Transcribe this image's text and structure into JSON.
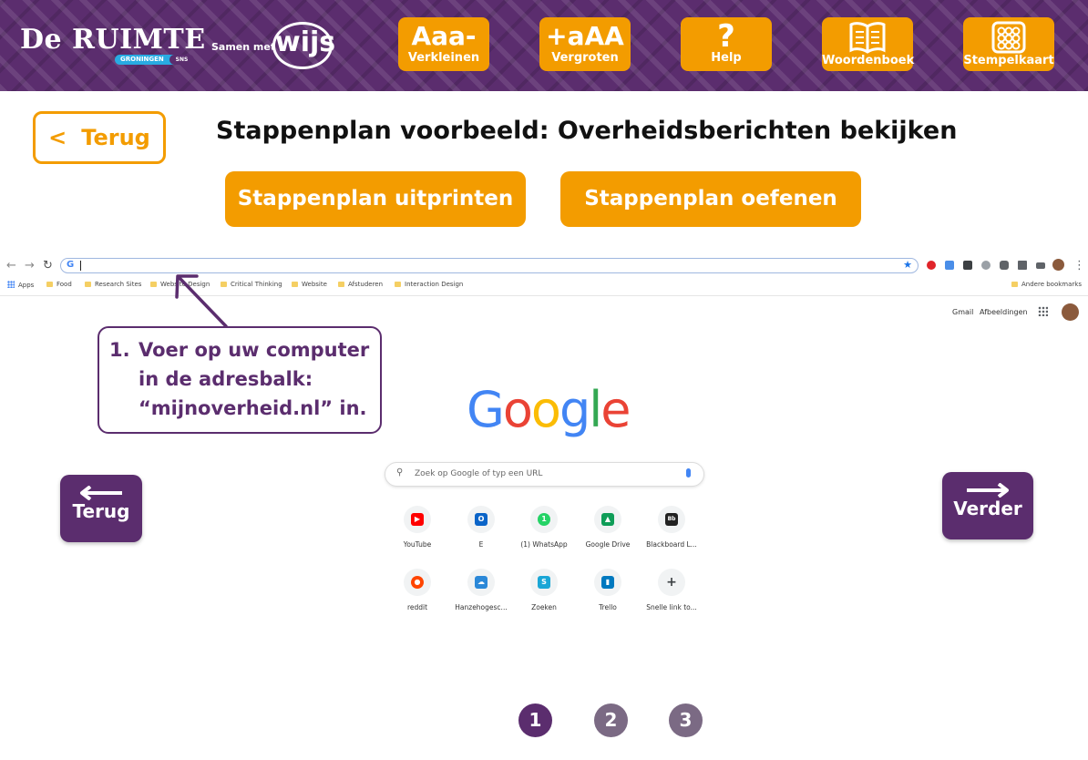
{
  "header": {
    "logo_main": "De RUIMTE",
    "logo_sub": "GRONINGEN",
    "logo_sns": "SNS",
    "samen_met": "Samen met",
    "wijs": "wijs",
    "tools": [
      {
        "big": "Aaa-",
        "label": "Verkleinen",
        "icon": "font-smaller-icon"
      },
      {
        "big": "+aAA",
        "label": "Vergroten",
        "icon": "font-bigger-icon"
      },
      {
        "big": "?",
        "label": "Help",
        "icon": "question-icon"
      },
      {
        "big": "",
        "label": "Woordenboek",
        "icon": "book-icon"
      },
      {
        "big": "",
        "label": "Stempelkaart",
        "icon": "stamp-card-icon"
      }
    ]
  },
  "back_button": {
    "chevron": "<",
    "label": "Terug"
  },
  "title": "Stappenplan voorbeeld: Overheidsberichten bekijken",
  "actions": {
    "print_label": "Stappenplan uitprinten",
    "practice_label": "Stappenplan oefenen"
  },
  "browser": {
    "omnibox_icon": "G",
    "bookmarks": [
      "Apps",
      "Food",
      "Research Sites",
      "Website Design",
      "Critical Thinking",
      "Website",
      "Afstuderen",
      "Interaction Design"
    ],
    "other_bookmarks": "Andere bookmarks",
    "links": {
      "gmail": "Gmail",
      "images": "Afbeeldingen"
    },
    "search_placeholder": "Zoek op Google of typ een URL",
    "shortcuts": [
      {
        "label": "YouTube",
        "glyph": "▶",
        "color": "#ff0000"
      },
      {
        "label": "E",
        "glyph": "O",
        "color": "#0a64c8"
      },
      {
        "label": "(1) WhatsApp",
        "glyph": "1",
        "color": "#25d366"
      },
      {
        "label": "Google Drive",
        "glyph": "▲",
        "color": "#0f9d58"
      },
      {
        "label": "Blackboard L...",
        "glyph": "Bb",
        "color": "#222222"
      },
      {
        "label": "reddit",
        "glyph": "●",
        "color": "#ff4500"
      },
      {
        "label": "Hanzehogesc...",
        "glyph": "☁",
        "color": "#2b88d8"
      },
      {
        "label": "Zoeken",
        "glyph": "S",
        "color": "#1aa6d6"
      },
      {
        "label": "Trello",
        "glyph": "▮",
        "color": "#0079bf"
      },
      {
        "label": "Snelle link to...",
        "glyph": "+",
        "color": "#5f6368"
      }
    ]
  },
  "google_letters": [
    "G",
    "o",
    "o",
    "g",
    "l",
    "e"
  ],
  "instruction": {
    "number": "1.",
    "text": "Voer op uw computer in de adresbalk: “mijnoverheid.nl” in."
  },
  "nav": {
    "prev_label": "Terug",
    "next_label": "Verder"
  },
  "steps": [
    "1",
    "2",
    "3"
  ],
  "colors": {
    "purple": "#5b2d6e",
    "orange": "#f39c00",
    "step_inactive": "#7b6a84"
  }
}
